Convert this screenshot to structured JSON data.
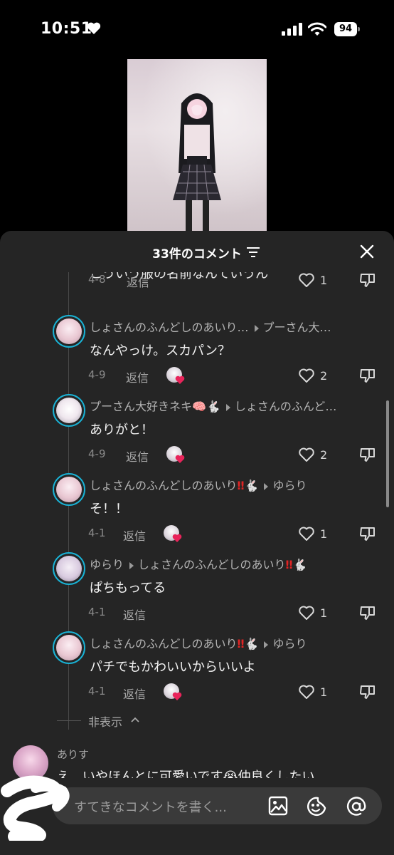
{
  "status": {
    "time": "10:51",
    "battery": "94"
  },
  "sheet": {
    "title": "33件のコメント",
    "cut_text": "こういう服の名前なんていうん",
    "first_meta": {
      "date": "4-8",
      "reply": "返信",
      "likes": "1"
    }
  },
  "replies": [
    {
      "user": "しょさんのふんどしのあいり…",
      "target": "プーさん大…",
      "marks": "",
      "text": "なんやっけ。スカパン？",
      "date": "4-9",
      "reply": "返信",
      "likes": "2"
    },
    {
      "user": "プーさん大好きネキ",
      "marks": "🧠🐇",
      "target": "しょさんのふんど…",
      "text": "ありがと！",
      "date": "4-9",
      "reply": "返信",
      "likes": "2"
    },
    {
      "user": "しょさんのふんどしのあいり",
      "marks": "‼🐇",
      "target": "ゆらり",
      "text": "そ！！",
      "date": "4-1",
      "reply": "返信",
      "likes": "1"
    },
    {
      "user": "ゆらり",
      "marks": "",
      "target": "しょさんのふんどしのあいり",
      "target_marks": "‼🐇",
      "text": "ぱちもってる",
      "date": "4-1",
      "reply": "返信",
      "likes": "1"
    },
    {
      "user": "しょさんのふんどしのあいり",
      "marks": "‼🐇",
      "target": "ゆらり",
      "text": "パチでもかわいいからいいよ",
      "date": "4-1",
      "reply": "返信",
      "likes": "1"
    }
  ],
  "hide_label": "非表示",
  "next_comment": {
    "user": "ありす",
    "text": "え、いやほんとに可愛いです😭仲良くしたい"
  },
  "input": {
    "placeholder": "すてきなコメントを書く..."
  },
  "colors": {
    "sheet_bg": "#252525",
    "avatar_ring": "#19b3d6",
    "creator_heart": "#e8245a"
  }
}
